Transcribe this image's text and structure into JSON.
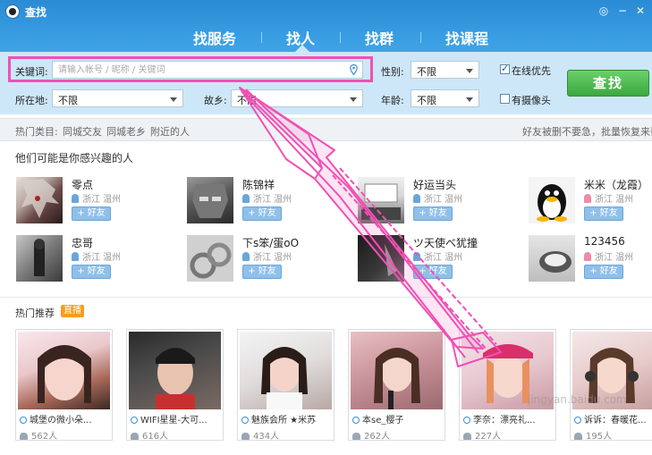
{
  "window": {
    "title": "查找",
    "controls": [
      "chat-icon",
      "minimize-icon",
      "close-icon"
    ]
  },
  "tabs": [
    {
      "label": "找服务",
      "active": false
    },
    {
      "label": "找人",
      "active": true
    },
    {
      "label": "找群",
      "active": false
    },
    {
      "label": "找课程",
      "active": false
    }
  ],
  "search": {
    "keyword_label": "关键词:",
    "keyword_placeholder": "请输入帐号 / 昵称 / 关键词",
    "gender_label": "性别:",
    "gender_value": "不限",
    "location_label": "所在地:",
    "location_value": "不限",
    "hometown_label": "故乡:",
    "hometown_value": "不限",
    "age_label": "年龄:",
    "age_value": "不限",
    "online_first_label": "在线优先",
    "online_first_checked": true,
    "has_camera_label": "有摄像头",
    "has_camera_checked": false,
    "submit_label": "查找"
  },
  "hot_bar": {
    "label": "热门类目:",
    "items": [
      "同城交友",
      "同城老乡",
      "附近的人"
    ],
    "notice": "好友被删不要急，批量恢复来帮"
  },
  "interest": {
    "title": "他们可能是你感兴趣的人",
    "add_label": "+ 好友",
    "people": [
      {
        "name": "零点",
        "location": "浙江 温州",
        "gender": "male"
      },
      {
        "name": "陈锦祥",
        "location": "浙江 温州",
        "gender": "male"
      },
      {
        "name": "好运当头",
        "location": "浙江 温州",
        "gender": "male"
      },
      {
        "name": "米米（龙霞）",
        "location": "浙江 温州",
        "gender": "female"
      },
      {
        "name": "忠哥",
        "location": "浙江 温州",
        "gender": "male"
      },
      {
        "name": "下s笨/蛋oO",
        "location": "浙江 温州",
        "gender": "male"
      },
      {
        "name": "ツ天使べ犹撞",
        "location": "浙江 温州",
        "gender": "male"
      },
      {
        "name": "123456",
        "location": "浙江 温州",
        "gender": "female"
      }
    ]
  },
  "recommend": {
    "title": "热门推荐",
    "live_badge": "直播",
    "cards": [
      {
        "name": "城堡の微小朵...",
        "count": "562人"
      },
      {
        "name": "WIFI星星-大可...",
        "count": "616人"
      },
      {
        "name": "魅族会所 ★米苏",
        "count": "434人"
      },
      {
        "name": "本se_樱子",
        "count": "262人"
      },
      {
        "name": "李奈：漂亮礼...",
        "count": "227人"
      },
      {
        "name": "诉诉：春暖花...",
        "count": "195人"
      }
    ]
  },
  "watermark": "jingyan.baidu.com",
  "colors": {
    "header_blue": "#3a9fe4",
    "panel_blue": "#cde7f8",
    "search_green": "#3ba83f",
    "annotation_pink": "#f24fb4",
    "live_orange": "#f89b1d"
  }
}
